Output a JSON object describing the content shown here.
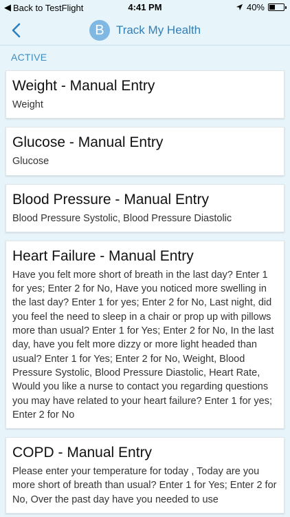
{
  "status_bar": {
    "back_app": "Back to TestFlight",
    "time": "4:41 PM",
    "battery": "40%",
    "battery_level": 0.4,
    "icons": [
      "back-chevron-icon",
      "location-arrow-icon",
      "battery-icon"
    ]
  },
  "nav": {
    "avatar_letter": "B",
    "title": "Track My Health",
    "back_icon": "chevron-left-icon"
  },
  "section": {
    "label": "ACTIVE"
  },
  "cards": [
    {
      "title": "Weight - Manual Entry",
      "description": "Weight"
    },
    {
      "title": "Glucose - Manual Entry",
      "description": "Glucose"
    },
    {
      "title": "Blood Pressure - Manual Entry",
      "description": "Blood Pressure Systolic, Blood Pressure Diastolic"
    },
    {
      "title": "Heart Failure - Manual Entry",
      "description": "Have you felt more short of breath in the last day? Enter 1 for yes; Enter 2 for No, Have you noticed more swelling in the last day? Enter 1 for yes; Enter 2 for No, Last night, did you feel the need to sleep in a chair or prop up with pillows more than usual?  Enter 1 for Yes; Enter 2 for No, In the last day, have you felt more dizzy or more light headed than usual?  Enter 1 for Yes; Enter 2 for No, Weight, Blood Pressure Systolic, Blood Pressure Diastolic, Heart Rate, Would you like a nurse to contact you regarding questions you may have related to your heart failure?  Enter 1 for yes; Enter 2 for No"
    },
    {
      "title": "COPD - Manual Entry",
      "description": "Please enter your temperature for today , Today are you more short of breath than usual?   Enter 1 for Yes; Enter 2 for No, Over the past day have you needed to use"
    }
  ],
  "colors": {
    "background": "#e7f4fa",
    "accent": "#2f7fb8",
    "avatar": "#7fb8e2",
    "section_label": "#3e8cbf"
  }
}
